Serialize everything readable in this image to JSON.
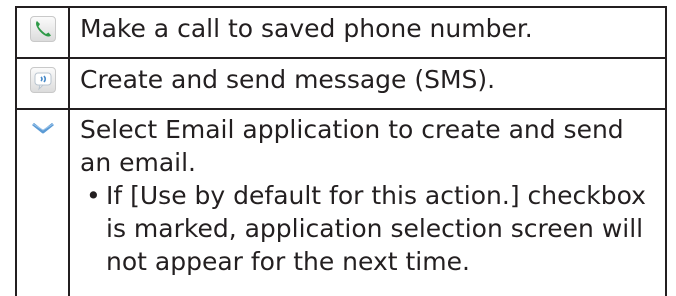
{
  "rows": [
    {
      "icon": "phone-icon",
      "text": "Make a call to saved phone number."
    },
    {
      "icon": "sms-icon",
      "text": "Create and send message (SMS)."
    },
    {
      "icon": "email-icon",
      "text": "Select Email application to create and send an email.",
      "bullet_mark": "•",
      "bullet": "If [Use by default for this action.] checkbox is marked, application selection screen will not appear for the next time."
    }
  ],
  "colors": {
    "text": "#231f20",
    "border": "#231f20",
    "phone_green": "#2f9a48",
    "sms_blue": "#4a8bc9",
    "email_blue": "#5b9bd5"
  }
}
